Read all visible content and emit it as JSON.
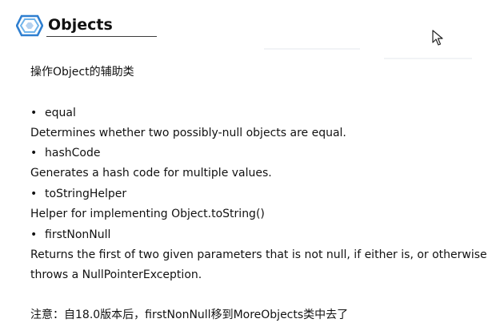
{
  "slide": {
    "title": "Objects",
    "subtitle": "操作Object的辅助类",
    "items": [
      {
        "name": "equal",
        "description": "Determines whether two possibly-null objects are equal."
      },
      {
        "name": "hashCode",
        "description": "Generates a hash code for multiple values."
      },
      {
        "name": "toStringHelper",
        "description": "Helper for implementing  Object.toString()"
      },
      {
        "name": "firstNonNull",
        "description_line1": "Returns the first of two given parameters that is not null, if either is, or otherwise",
        "description_line2": "throws a NullPointerException."
      }
    ],
    "note": "注意：自18.0版本后，firstNonNull移到MoreObjects类中去了",
    "bullet_glyph": "•"
  },
  "colors": {
    "logo_outer": "#2f7fd0",
    "logo_inner": "#6fb3ea",
    "text": "#111111",
    "rule": "#3c3c3c"
  },
  "icons": {
    "logo": "hexagon-logo-icon",
    "cursor": "mouse-pointer-icon"
  }
}
